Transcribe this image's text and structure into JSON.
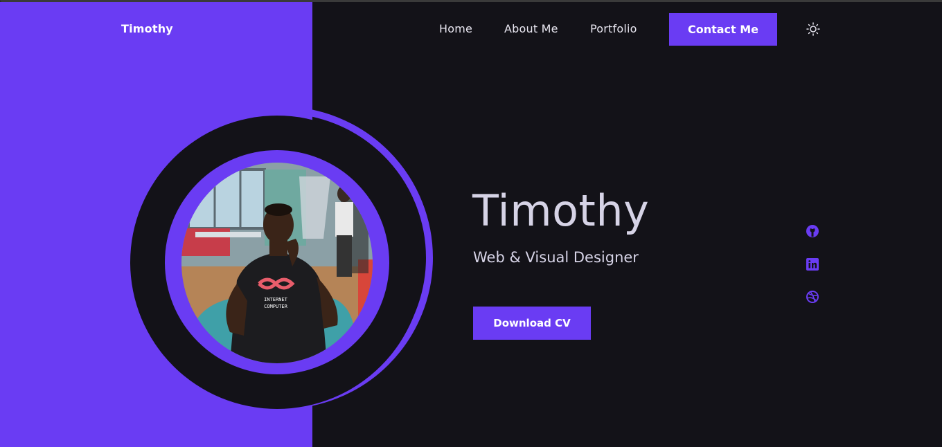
{
  "nav": {
    "logo": "Timothy",
    "links": [
      "Home",
      "About Me",
      "Portfolio"
    ],
    "contact_label": "Contact Me",
    "theme_icon": "sun-icon"
  },
  "hero": {
    "name": "Timothy",
    "role": "Web & Visual Designer",
    "download_label": "Download CV",
    "photo_shirt_text": [
      "INTERNET",
      "COMPUTER"
    ]
  },
  "social": [
    "github-icon",
    "linkedin-icon",
    "dribbble-icon"
  ],
  "colors": {
    "accent": "#6a3cf3",
    "background": "#131218",
    "text": "#d6d3e6"
  }
}
